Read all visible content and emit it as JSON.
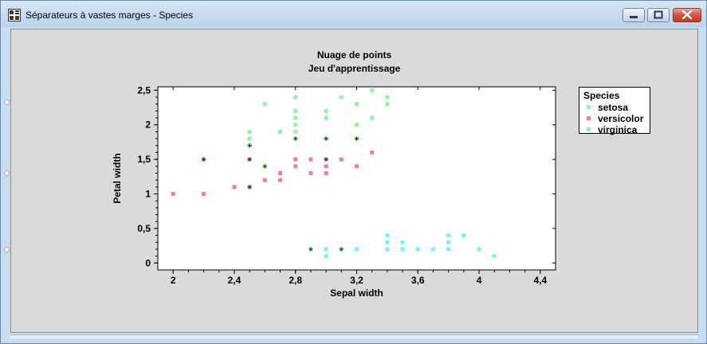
{
  "window": {
    "title": "Séparateurs à vastes marges - Species",
    "icon": "chart-app-icon",
    "controls": [
      "minimize-icon",
      "maximize-icon",
      "close-icon"
    ]
  },
  "chart": {
    "title": "Nuage de points",
    "subtitle": "Jeu d'apprentissage"
  },
  "chart_data": {
    "type": "scatter",
    "title": "Nuage de points",
    "subtitle": "Jeu d'apprentissage",
    "xlabel": "Sepal width",
    "ylabel": "Petal width",
    "xlim": [
      1.9,
      4.5
    ],
    "ylim": [
      -0.1,
      2.55
    ],
    "x_ticks": [
      "2",
      "2,4",
      "2,8",
      "3,2",
      "3,6",
      "4",
      "4,4"
    ],
    "y_ticks": [
      "0",
      "0,5",
      "1",
      "1,5",
      "2",
      "2,5"
    ],
    "grid": false,
    "legend": {
      "title": "Species",
      "position": "right"
    },
    "series": [
      {
        "name": "setosa",
        "color": "#7ff0f6",
        "points": [
          [
            2.9,
            0.2
          ],
          [
            3.0,
            0.1
          ],
          [
            3.0,
            0.2
          ],
          [
            3.1,
            0.2
          ],
          [
            3.2,
            0.2
          ],
          [
            3.4,
            0.2
          ],
          [
            3.4,
            0.3
          ],
          [
            3.4,
            0.4
          ],
          [
            3.5,
            0.2
          ],
          [
            3.5,
            0.3
          ],
          [
            3.6,
            0.2
          ],
          [
            3.7,
            0.2
          ],
          [
            3.8,
            0.2
          ],
          [
            3.8,
            0.3
          ],
          [
            3.8,
            0.4
          ],
          [
            3.9,
            0.4
          ],
          [
            4.0,
            0.2
          ],
          [
            4.1,
            0.1
          ]
        ]
      },
      {
        "name": "versicolor",
        "color": "#ee7fa3",
        "points": [
          [
            2.0,
            1.0
          ],
          [
            2.2,
            1.0
          ],
          [
            2.2,
            1.5
          ],
          [
            2.4,
            1.1
          ],
          [
            2.5,
            1.1
          ],
          [
            2.5,
            1.5
          ],
          [
            2.6,
            1.2
          ],
          [
            2.7,
            1.2
          ],
          [
            2.7,
            1.3
          ],
          [
            2.8,
            1.4
          ],
          [
            2.8,
            1.5
          ],
          [
            2.9,
            1.3
          ],
          [
            2.9,
            1.5
          ],
          [
            3.0,
            1.3
          ],
          [
            3.0,
            1.4
          ],
          [
            3.0,
            1.5
          ],
          [
            3.1,
            1.5
          ],
          [
            3.2,
            1.4
          ],
          [
            3.2,
            1.8
          ],
          [
            3.3,
            1.6
          ]
        ]
      },
      {
        "name": "virginica",
        "color": "#94f2a8",
        "points": [
          [
            2.5,
            1.7
          ],
          [
            2.5,
            1.8
          ],
          [
            2.5,
            1.9
          ],
          [
            2.6,
            1.4
          ],
          [
            2.6,
            2.3
          ],
          [
            2.7,
            1.9
          ],
          [
            2.8,
            1.8
          ],
          [
            2.8,
            1.9
          ],
          [
            2.8,
            2.0
          ],
          [
            2.8,
            2.1
          ],
          [
            2.8,
            2.2
          ],
          [
            2.8,
            2.4
          ],
          [
            3.0,
            1.8
          ],
          [
            3.0,
            2.1
          ],
          [
            3.0,
            2.2
          ],
          [
            3.1,
            2.4
          ],
          [
            3.2,
            1.8
          ],
          [
            3.2,
            2.0
          ],
          [
            3.2,
            2.3
          ],
          [
            3.3,
            2.1
          ],
          [
            3.3,
            2.5
          ],
          [
            3.4,
            2.3
          ],
          [
            3.4,
            2.4
          ]
        ]
      }
    ],
    "support_vectors": {
      "marker": "+",
      "color": "#1a3a1a",
      "points": [
        [
          2.2,
          1.5
        ],
        [
          2.5,
          1.1
        ],
        [
          2.5,
          1.5
        ],
        [
          2.5,
          1.7
        ],
        [
          2.6,
          1.4
        ],
        [
          2.8,
          1.8
        ],
        [
          2.9,
          0.2
        ],
        [
          3.0,
          1.5
        ],
        [
          3.0,
          1.8
        ],
        [
          3.1,
          0.2
        ],
        [
          3.2,
          1.8
        ]
      ]
    }
  }
}
